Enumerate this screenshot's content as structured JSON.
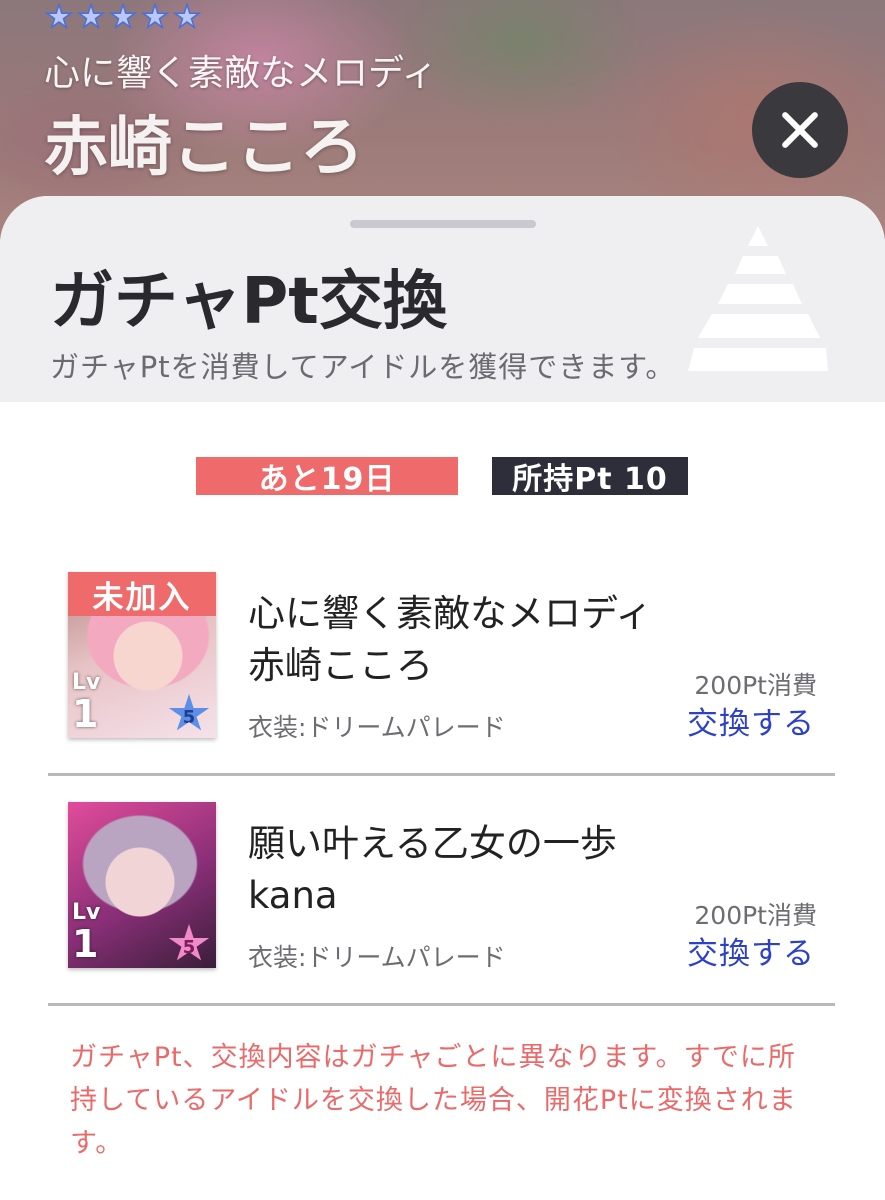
{
  "header": {
    "rarity_stars": 5,
    "card_subtitle": "心に響く素敵なメロディ",
    "card_name": "赤崎こころ"
  },
  "sheet": {
    "title": "ガチャPt交換",
    "description": "ガチャPtを消費してアイドルを獲得できます。"
  },
  "status": {
    "days_left": "あと19日",
    "owned_pt": "所持Pt 10"
  },
  "items": [
    {
      "new_tag": "未加入",
      "title_line1": "心に響く素敵なメロディ",
      "title_line2": "赤崎こころ",
      "costume": "衣装:ドリームパレード",
      "cost": "200Pt消費",
      "action": "交換する",
      "lv_label": "Lv",
      "lv_value": "1",
      "rank": "5"
    },
    {
      "title_line1": "願い叶える乙女の一歩",
      "title_line2": "kana",
      "costume": "衣装:ドリームパレード",
      "cost": "200Pt消費",
      "action": "交換する",
      "lv_label": "Lv",
      "lv_value": "1",
      "rank": "5"
    }
  ],
  "notice": {
    "text": "ガチャPt、交換内容はガチャごとに異なります。すでに所持しているアイドルを交換した場合、開花Ptに変換されます。"
  },
  "colors": {
    "accent_red": "#ef6b6b",
    "link_blue": "#2c41c8",
    "dark_badge": "#2e2e3a"
  }
}
